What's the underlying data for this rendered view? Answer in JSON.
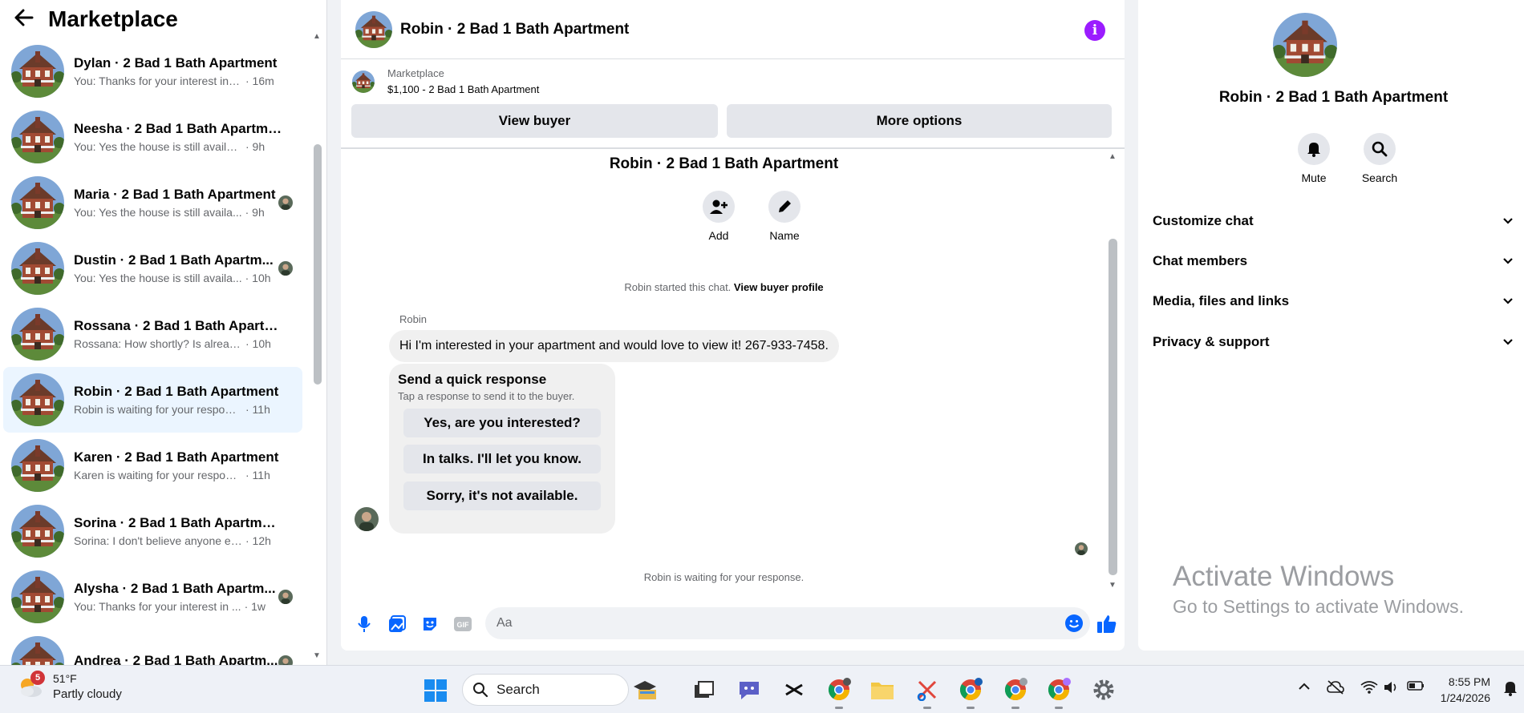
{
  "sidebar": {
    "title": "Marketplace",
    "conversations": [
      {
        "title": "Dylan · 2 Bad 1 Bath Apartment",
        "snippet": "You: Thanks for your interest in t...",
        "time": "· 16m",
        "seen": false
      },
      {
        "title": "Neesha · 2 Bad 1 Bath Apartment",
        "snippet": "You: Yes the house is still available ...",
        "time": "· 9h",
        "seen": false
      },
      {
        "title": "Maria · 2 Bad 1 Bath Apartment",
        "snippet": "You: Yes the house is still availa...",
        "time": "· 9h",
        "seen": true
      },
      {
        "title": "Dustin · 2 Bad 1 Bath Apartm...",
        "snippet": "You: Yes the house is still availa...",
        "time": "· 10h",
        "seen": true
      },
      {
        "title": "Rossana · 2 Bad 1 Bath Apartment",
        "snippet": "Rossana: How shortly? Is already ...",
        "time": "· 10h",
        "seen": false
      },
      {
        "title": "Robin · 2 Bad 1 Bath Apartment",
        "snippet": "Robin is waiting for your response.",
        "time": "· 11h",
        "seen": false
      },
      {
        "title": "Karen · 2 Bad 1 Bath Apartment",
        "snippet": "Karen is waiting for your response.",
        "time": "· 11h",
        "seen": false
      },
      {
        "title": "Sorina · 2 Bad 1 Bath Apartment",
        "snippet": "Sorina: I don't believe anyone ev...",
        "time": "· 12h",
        "seen": false
      },
      {
        "title": "Alysha · 2 Bad 1 Bath Apartm...",
        "snippet": "You: Thanks for your interest in ...",
        "time": "· 1w",
        "seen": true
      },
      {
        "title": "Andrea · 2 Bad 1 Bath Apartm...",
        "snippet": "",
        "time": "",
        "seen": true
      }
    ],
    "active_index": 5
  },
  "chat": {
    "title": "Robin · 2 Bad 1 Bath Apartment",
    "marketplace_label": "Marketplace",
    "listing": "$1,100 - 2 Bad 1 Bath Apartment",
    "view_buyer": "View buyer",
    "more_options": "More options",
    "intro_title": "Robin · 2 Bad 1 Bath Apartment",
    "add_label": "Add",
    "name_label": "Name",
    "started_text": "Robin started this chat.",
    "view_profile": "View buyer profile",
    "sender": "Robin",
    "message": "Hi I'm interested in your apartment and would love to view it! 267-933-7458.",
    "quick_title": "Send a quick response",
    "quick_sub": "Tap a response to send it to the buyer.",
    "quick_responses": [
      "Yes, are you interested?",
      "In talks. I'll let you know.",
      "Sorry, it's not available."
    ],
    "waiting_text": "Robin is waiting for your response.",
    "composer_placeholder": "Aa"
  },
  "info_panel": {
    "name": "Robin · 2 Bad 1 Bath Apartment",
    "mute_label": "Mute",
    "search_label": "Search",
    "sections": [
      "Customize chat",
      "Chat members",
      "Media, files and links",
      "Privacy & support"
    ]
  },
  "watermark": {
    "line1": "Activate Windows",
    "line2": "Go to Settings to activate Windows."
  },
  "taskbar": {
    "weather_badge": "5",
    "temperature": "51°F",
    "condition": "Partly cloudy",
    "search_label": "Search",
    "time": "8:55 PM",
    "date": "1/24/2026"
  },
  "colors": {
    "accent": "#0866ff",
    "info_purple": "#9b1cff",
    "active_row": "#ebf5ff"
  }
}
